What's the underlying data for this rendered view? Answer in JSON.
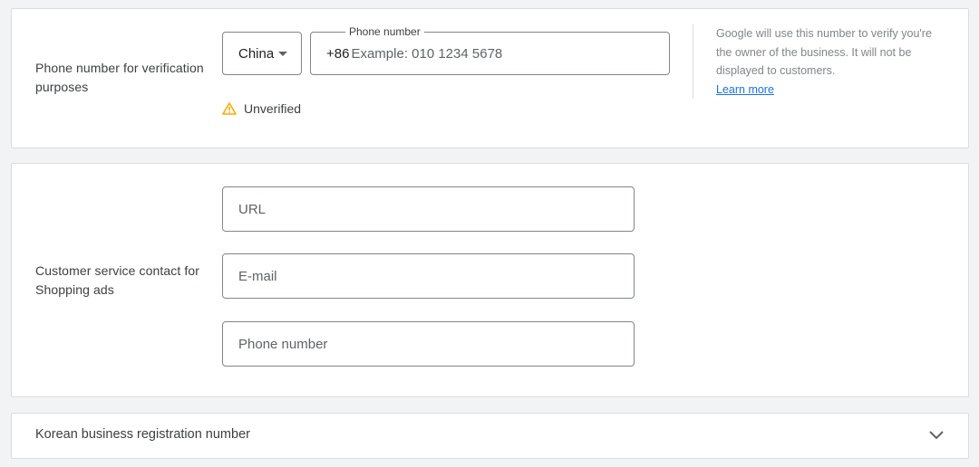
{
  "phone_section": {
    "label": "Phone number for verification purposes",
    "country": {
      "selected": "China"
    },
    "phone_field": {
      "label": "Phone number",
      "prefix": "+86",
      "placeholder": "Example: 010 1234 5678",
      "value": ""
    },
    "status": {
      "text": "Unverified",
      "icon": "warning-icon",
      "icon_color": "#f9ab00"
    },
    "help": {
      "text": "Google will use this number to verify you're the owner of the business. It will not be displayed to customers.",
      "link": "Learn more"
    }
  },
  "customer_service": {
    "label": "Customer service contact for Shopping ads",
    "fields": [
      {
        "placeholder": "URL",
        "value": ""
      },
      {
        "placeholder": "E-mail",
        "value": ""
      },
      {
        "placeholder": "Phone number",
        "value": ""
      }
    ]
  },
  "korean": {
    "label": "Korean business registration number",
    "icon": "chevron-down-icon"
  },
  "colors": {
    "link": "#1a73e8",
    "border": "#80868b",
    "warning": "#f9ab00"
  }
}
